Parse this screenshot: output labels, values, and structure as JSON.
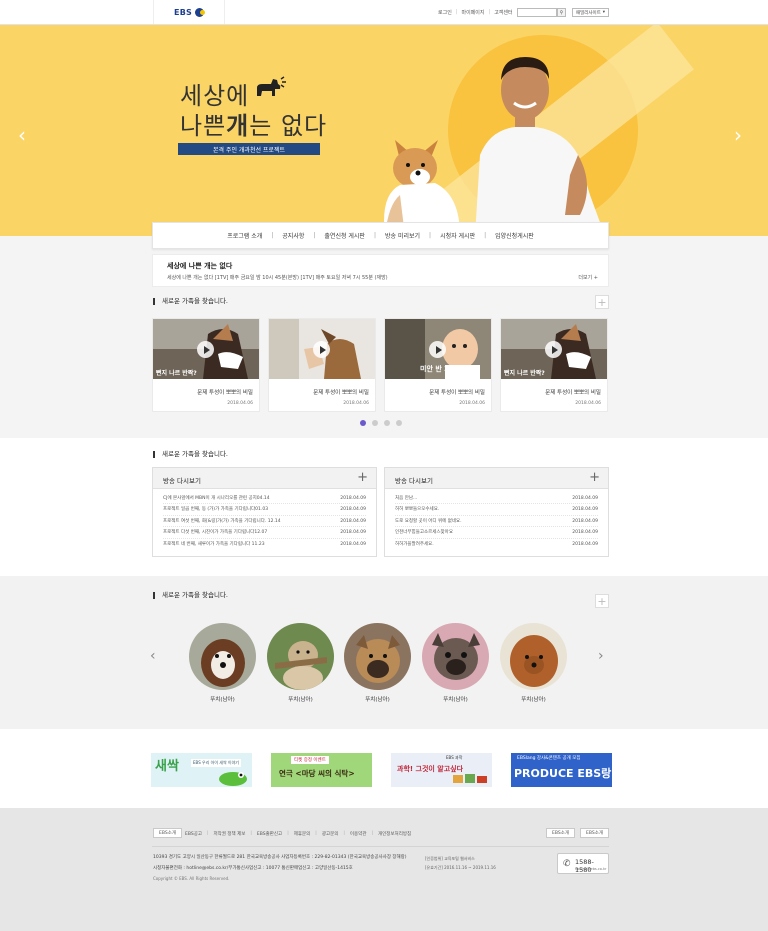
{
  "header": {
    "logo_text": "EBS",
    "nav": [
      "로그인",
      "마이페이지",
      "고객센터"
    ],
    "search_placeholder": "",
    "family_site": "패밀리사이트"
  },
  "hero": {
    "title_line1": "세상에",
    "title_line2_pre": "나쁜",
    "title_line2_bold": "개",
    "title_line2_post": "는 없다",
    "subtitle": "본격 주인 개과천선 프로젝트",
    "bg_color": "#fbd466"
  },
  "menu": [
    "프로그램 소개",
    "공지사항",
    "출연신청 게시판",
    "방송 미리보기",
    "시청자 게시판",
    "입양신청게시판"
  ],
  "program": {
    "title": "세상에 나쁜 개는 없다",
    "schedule": "세상에 나쁜 개는 없다 [1TV] 매주 금요일 밤 10시 45분(본방) [1TV] 매주 토요일 저녁 7시 55분 (재방)",
    "more": "더보기 +"
  },
  "section1": {
    "title": "새로운 가족을 찾습니다.",
    "cards": [
      {
        "title": "문제 투성이 뽀뽀의 비밀",
        "date": "2018.04.06"
      },
      {
        "title": "문제 투성이 뽀뽀의 비밀",
        "date": "2018.04.06"
      },
      {
        "title": "문제 투성이 뽀뽀의 비밀",
        "date": "2018.04.06"
      },
      {
        "title": "문제 투성이 뽀뽀의 비밀",
        "date": "2018.04.06"
      }
    ]
  },
  "section2": {
    "title": "새로운 가족을 찾습니다.",
    "boards": [
      {
        "title": "방송 다시보기",
        "items": [
          {
            "text": "CJ에 본사앞에서 MBN이 개 시나리오를 관련 공지04.14",
            "date": "2018.04.09"
          },
          {
            "text": "프로젝트 일곱 번째, 동 (가)가 가족을 기다립니다01.03",
            "date": "2018.04.09"
          },
          {
            "text": "프로젝트 여섯 번째, 화[&링]가(가) 가족을 기다립니다. 12.14",
            "date": "2018.04.09"
          },
          {
            "text": "프로젝트 다섯 번째, 시진이가 가족을 기다립니다12.07",
            "date": "2018.04.09"
          },
          {
            "text": "프로젝트 네 번째, 새루이가 가족을 기다립니다 11.23",
            "date": "2018.04.09"
          }
        ]
      },
      {
        "title": "방송 다시보기",
        "items": [
          {
            "text": "처음 만남...",
            "date": "2018.04.09"
          },
          {
            "text": "허허 뽀뽀들으오수세요.",
            "date": "2018.04.09"
          },
          {
            "text": "도로 요청할 곳이 어디 위에 없네요.",
            "date": "2018.04.09"
          },
          {
            "text": "인천너무힘들고소르세스찾아요",
            "date": "2018.04.09"
          },
          {
            "text": "허허가을팔려주세요.",
            "date": "2018.04.09"
          }
        ]
      }
    ]
  },
  "section3": {
    "title": "새로운 가족을 찾습니다.",
    "dogs": [
      {
        "name": "뚜치(남아)"
      },
      {
        "name": "뚜치(남아)"
      },
      {
        "name": "뚜치(남아)"
      },
      {
        "name": "뚜치(남아)"
      },
      {
        "name": "뚜치(남아)"
      }
    ]
  },
  "banners": [
    {
      "text": "새싹",
      "sub": "EBS 우리 아이 새싹 이야기"
    },
    {
      "text": "연극 <마당 씨의 식탁>",
      "sub": "티켓 증정 이벤트"
    },
    {
      "text": "과학! 그것이 알고싶다",
      "sub": "EBS 과학"
    },
    {
      "text": "PRODUCE EBS랑",
      "sub": "EBSlang 강사&콘텐츠 공개 모집"
    }
  ],
  "footer": {
    "btn_left": "EBS소개",
    "links": [
      "EBS공고",
      "저작권 정책 제보",
      "EBS출판신고",
      "제휴문의",
      "광고문의",
      "이용약관",
      "개인정보처리방침"
    ],
    "btn_right1": "EBS소개",
    "btn_right2": "EBS소개",
    "address": "10393 경기도 고양시 일산동구 한류월드로 281 한국교육방송공사 사업자등록번호 : 229-82-01343 (한국교육방송공사사장 장해랑)",
    "contact": "시청자불편전화 : hotline@ebs.co.kr/부가통신사업신고 : 10077 통신판매업신고 : 고양일산동-1415호",
    "copyright": "Copyright © EBS. All Rights Reserved.",
    "info1": "[인증범위] 교육포털 웹서비스",
    "info2": "[유효기간] 2016.11.16 ~ 2019.11.16",
    "phone": "1588-1580",
    "email": "hotline@ebs.co.kr"
  }
}
